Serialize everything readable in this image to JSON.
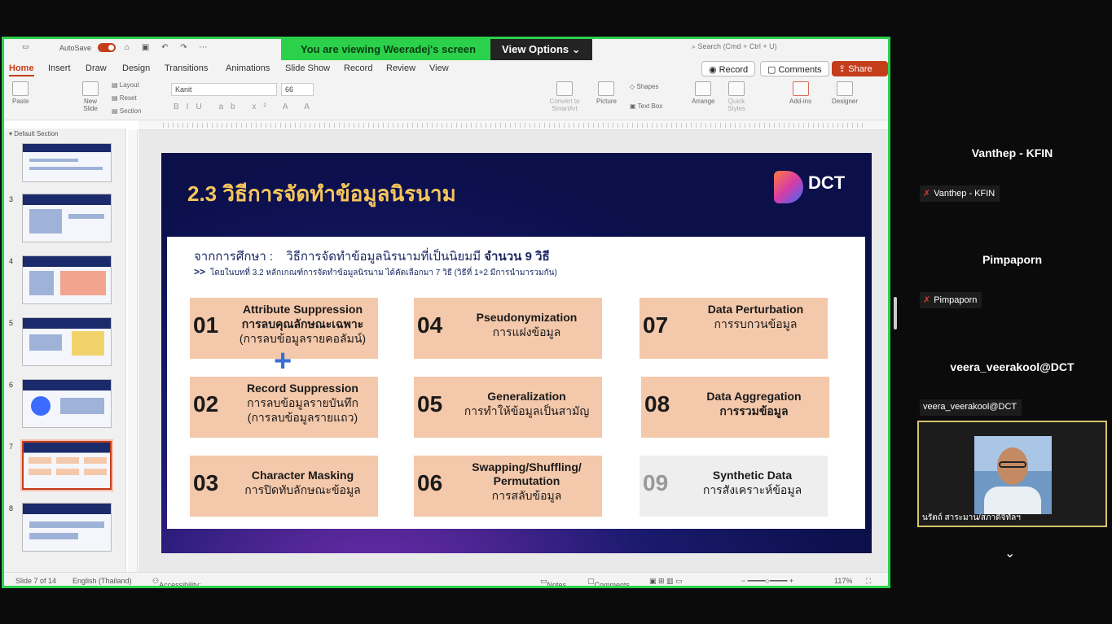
{
  "banner": {
    "viewing_text": "You are viewing  Weeradej's screen",
    "view_options": "View Options"
  },
  "titlebar": {
    "autosave": "AutoSave",
    "search_placeholder": "Search (Cmd + Ctrl + U)"
  },
  "menu": {
    "tabs": [
      "Home",
      "Insert",
      "Draw",
      "Design",
      "Transitions",
      "Animations",
      "Slide Show",
      "Record",
      "Review",
      "View"
    ],
    "record": "Record",
    "comments": "Comments",
    "share": "Share"
  },
  "ribbon": {
    "paste": "Paste",
    "new_slide": "New Slide",
    "layout": "Layout",
    "reset": "Reset",
    "section": "Section",
    "font": "Kanit",
    "size": "66",
    "convert": "Convert to SmartArt",
    "picture": "Picture",
    "shapes": "Shapes",
    "text_box": "Text Box",
    "arrange": "Arrange",
    "quick_styles": "Quick Styles",
    "add_ins": "Add-ins",
    "designer": "Designer"
  },
  "thumbnails": {
    "section": "Default Section",
    "numbers": [
      "3",
      "4",
      "5",
      "6",
      "7",
      "8"
    ],
    "selected": "7"
  },
  "slide": {
    "title": "2.3 วิธีการจัดทำข้อมูลนิรนาม",
    "logo": "DCT",
    "intro_label": "จากการศึกษา :",
    "intro_text": "วิธีการจัดทำข้อมูลนิรนามที่เป็นนิยมมี",
    "intro_count": "จำนวน 9 วิธี",
    "note_arrow": ">>",
    "note_text": "โดยในบทที่ 3.2 หลักเกณฑ์การจัดทำข้อมูลนิรนาม ได้คัดเลือกมา 7 วิธี (วิธีที่ 1+2 มีการนำมารวมกัน)",
    "plus": "+",
    "cards": [
      {
        "num": "01",
        "en": "Attribute Suppression",
        "th1": "การลบคุณลักษณะเฉพาะ",
        "th2": "(การลบข้อมูลรายคอลัมน์)"
      },
      {
        "num": "02",
        "en": "Record Suppression",
        "th1": "การลบข้อมูลรายบันทึก",
        "th2": "(การลบข้อมูลรายแถว)"
      },
      {
        "num": "03",
        "en": "Character Masking",
        "th1": "การปิดทับลักษณะข้อมูล",
        "th2": ""
      },
      {
        "num": "04",
        "en": "Pseudonymization",
        "th1": "การแฝงข้อมูล",
        "th2": ""
      },
      {
        "num": "05",
        "en": "Generalization",
        "th1": "การทำให้ข้อมูลเป็นสามัญ",
        "th2": ""
      },
      {
        "num": "06",
        "en": "Swapping/Shuffling/ Permutation",
        "th1": "การสลับข้อมูล",
        "th2": ""
      },
      {
        "num": "07",
        "en": "Data Perturbation",
        "th1": "การรบกวนข้อมูล",
        "th2": ""
      },
      {
        "num": "08",
        "en": "Data Aggregation",
        "th1": "การรวมข้อมูล",
        "th2": ""
      },
      {
        "num": "09",
        "en": "Synthetic Data",
        "th1": "การสังเคราะห์ข้อมูล",
        "th2": ""
      }
    ]
  },
  "statusbar": {
    "slide_info": "Slide 7 of 14",
    "language": "English (Thailand)",
    "accessibility": "Accessibility: Investigate",
    "notes": "Notes",
    "comments": "Comments",
    "zoom": "117%"
  },
  "participants": [
    {
      "name": "Vanthep - KFIN",
      "label": "Vanthep - KFIN",
      "muted": true
    },
    {
      "name": "Pimpaporn",
      "label": "Pimpaporn",
      "muted": true
    },
    {
      "name": "veera_veerakool@DCT",
      "label": "veera_veerakool@DCT",
      "muted": false
    }
  ],
  "video": {
    "name": "นรัตถ์ สาระมาน/สภาดิจิทัลฯ"
  }
}
